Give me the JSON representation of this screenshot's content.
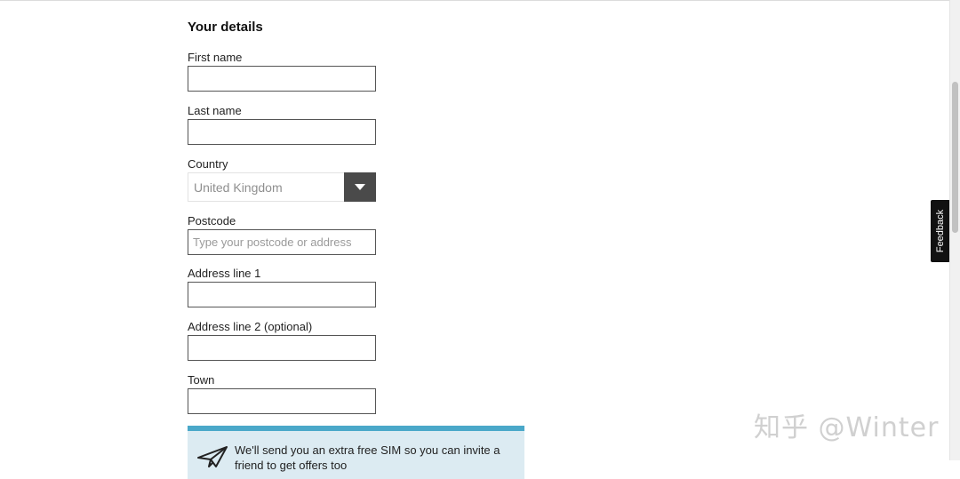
{
  "form": {
    "title": "Your details",
    "fields": [
      {
        "label": "First name",
        "value": "",
        "placeholder": ""
      },
      {
        "label": "Last name",
        "value": "",
        "placeholder": ""
      },
      {
        "label": "Postcode",
        "value": "",
        "placeholder": "Type your postcode or address"
      },
      {
        "label": "Address line 1",
        "value": "",
        "placeholder": ""
      },
      {
        "label": "Address line 2 (optional)",
        "value": "",
        "placeholder": ""
      },
      {
        "label": "Town",
        "value": "",
        "placeholder": ""
      }
    ],
    "country": {
      "label": "Country",
      "selected": "United Kingdom",
      "icon": "chevron-down-icon"
    }
  },
  "info_box": {
    "icon": "paper-plane-icon",
    "line1": "We'll send you an extra free SIM so you can invite a",
    "line2": "friend to get offers too",
    "accent_color": "#4aa8c9",
    "background_color": "#dcebf2"
  },
  "feedback_tab": {
    "label": "Feedback"
  },
  "watermark": {
    "text": "知乎 @Winter"
  }
}
